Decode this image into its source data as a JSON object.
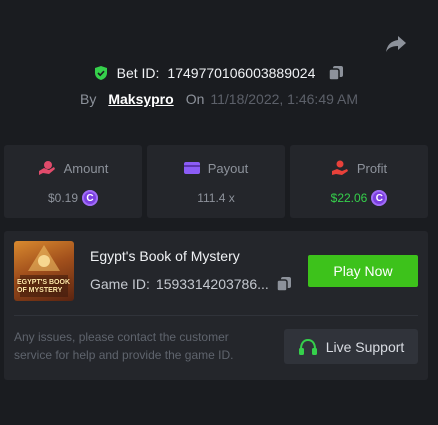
{
  "bet": {
    "label": "Bet ID:",
    "id": "1749770106003889024"
  },
  "author": {
    "by_label": "By",
    "username": "Maksypro",
    "on_label": "On",
    "date": "11/18/2022, 1:46:49 AM"
  },
  "stats": [
    {
      "label": "Amount",
      "value": "$0.19",
      "icon": "dollar-hand-icon"
    },
    {
      "label": "Payout",
      "value": "111.4 x",
      "icon": "wallet-icon"
    },
    {
      "label": "Profit",
      "value": "$22.06",
      "icon": "hand-coin-icon"
    }
  ],
  "game": {
    "name": "Egypt's Book of Mystery",
    "id_label": "Game ID:",
    "id_value": "1593314203786...",
    "thumbnail_title": "EGYPT'S BOOK OF MYSTERY",
    "play_label": "Play Now"
  },
  "support": {
    "text": "Any issues, please contact the customer service for help and provide the game ID.",
    "button_label": "Live Support"
  },
  "colors": {
    "background": "#1a1c20",
    "panel": "#24262b",
    "accent_green": "#3dc21b",
    "profit_green": "#35d04b",
    "amount_pink": "#e14b6b",
    "payout_purple": "#8b5cf6",
    "profit_red": "#e8413a",
    "coin_purple": "#7b3fe0"
  }
}
